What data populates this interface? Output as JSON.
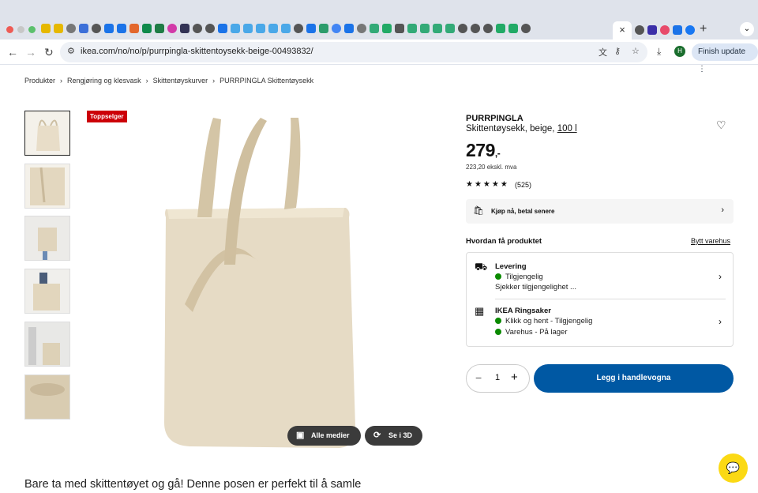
{
  "browser": {
    "active_tab_close": "×",
    "new_tab": "+",
    "tab_menu": "⌄",
    "url": "ikea.com/no/no/p/purrpingla-skittentoysekk-beige-00493832/",
    "back": "←",
    "forward": "→",
    "reload": "↻",
    "avatar_letter": "H",
    "finish_update": "Finish update",
    "menu": "⋮",
    "colors": {
      "tabbar": "#dfe3eb",
      "omnibox": "#eef1f6",
      "finish_bg": "#dce6f5"
    }
  },
  "breadcrumb": [
    "Produkter",
    "Rengjøring og klesvask",
    "Skittentøyskurver",
    "PURRPINGLA Skittentøysekk"
  ],
  "breadcrumb_sep": "›",
  "badge": "Toppselger",
  "media": {
    "all": "Alle medier",
    "view3d": "Se i 3D"
  },
  "product": {
    "name": "PURRPINGLA",
    "desc_prefix": "Skittentøysekk, beige, ",
    "desc_size": "100 l",
    "price_main": "279",
    "price_cents": ",-",
    "ex_vat": "223,20 ekskl. mva",
    "stars": "★★★★★",
    "rating_count": "(525)",
    "pay_later": "Kjøp nå, betal senere"
  },
  "delivery": {
    "heading": "Hvordan få produktet",
    "change_store": "Bytt varehus",
    "rows": [
      {
        "title": "Levering",
        "lines": [
          "Tilgjengelig",
          "Sjekker tilgjengelighet ..."
        ]
      },
      {
        "title": "IKEA Ringsaker",
        "lines": [
          "Klikk og hent - Tilgjengelig",
          "Varehus - På lager"
        ]
      }
    ],
    "status_color": "#0a8a00"
  },
  "cart": {
    "minus": "−",
    "qty": "1",
    "plus": "+",
    "add_label": "Legg i handlevogna",
    "color": "#0058a3"
  },
  "tagline": "Bare ta med skittentøyet og gå! Denne posen er perfekt til å samle",
  "icons": {
    "heart": "♡",
    "chevron": "›",
    "truck": "⛟",
    "store": "▦",
    "chat": "💬",
    "media": "▣",
    "rotate": "⟳",
    "bag": "🛍"
  }
}
